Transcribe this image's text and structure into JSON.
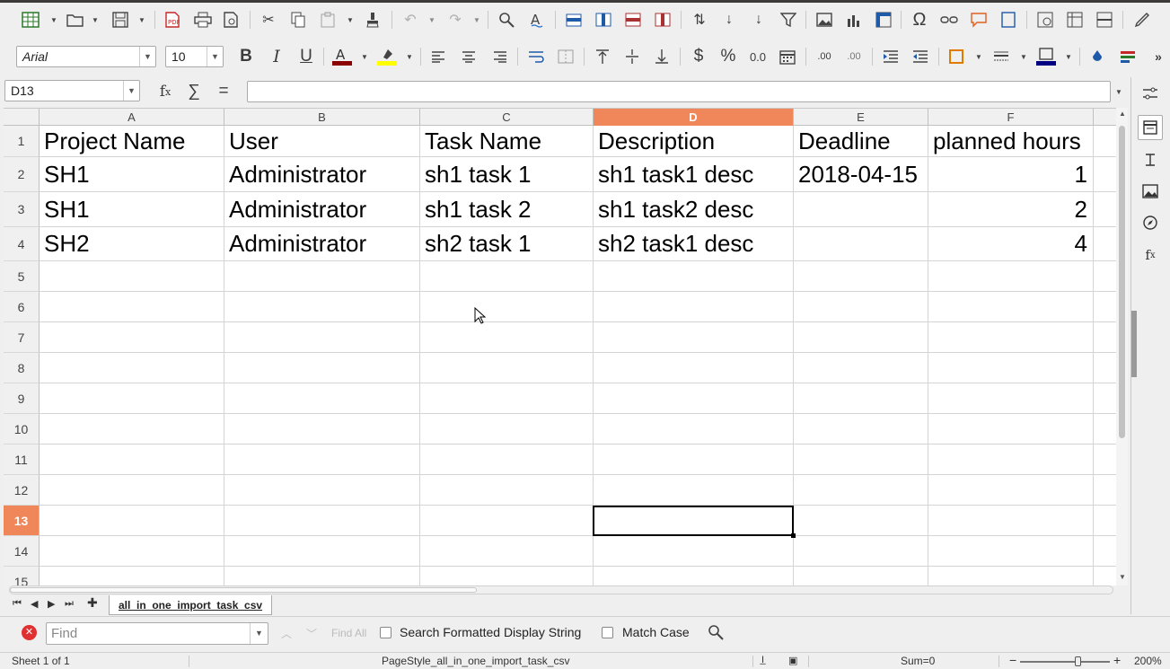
{
  "toolbar2": {
    "font_name": "Arial",
    "font_size": "10"
  },
  "formula_bar": {
    "name_box": "D13",
    "content": ""
  },
  "columns": [
    "A",
    "B",
    "C",
    "D",
    "E",
    "F"
  ],
  "rows": [
    "1",
    "2",
    "3",
    "4",
    "5",
    "6",
    "7",
    "8",
    "9",
    "10",
    "11",
    "12",
    "13",
    "14",
    "15"
  ],
  "cells": {
    "r1": [
      "Project Name",
      "User",
      "Task Name",
      "Description",
      "Deadline",
      "planned hours"
    ],
    "r2": [
      "SH1",
      "Administrator",
      "sh1 task 1",
      "sh1 task1 desc",
      "2018-04-15",
      "1"
    ],
    "r3": [
      "SH1",
      "Administrator",
      "sh1 task 2",
      "sh1 task2 desc",
      "",
      "2"
    ],
    "r4": [
      "SH2",
      "Administrator",
      "sh2 task 1",
      "sh2 task1 desc",
      "",
      "4"
    ]
  },
  "sheet_tab": "all_in_one_import_task_csv",
  "find_bar": {
    "placeholder": "Find",
    "find_all": "Find All",
    "search_formatted": "Search Formatted Display String",
    "match_case": "Match Case"
  },
  "status_bar": {
    "sheet": "Sheet 1 of 1",
    "page_style": "PageStyle_all_in_one_import_task_csv",
    "sum": "Sum=0",
    "zoom": "200%"
  },
  "colors": {
    "selected_header": "#f0875a",
    "grid_line": "#d4d4d4"
  }
}
